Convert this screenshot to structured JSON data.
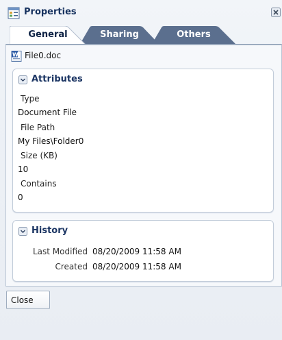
{
  "dialog": {
    "title": "Properties",
    "icon": "properties-icon",
    "close_icon": "close-icon"
  },
  "tabs": [
    {
      "label": "General",
      "selected": true
    },
    {
      "label": "Sharing",
      "selected": false
    },
    {
      "label": "Others",
      "selected": false
    }
  ],
  "file": {
    "name": "File0.doc",
    "icon": "word-document-icon"
  },
  "attributes": {
    "title": "Attributes",
    "items": [
      {
        "label": "Type",
        "value": "Document File"
      },
      {
        "label": "File Path",
        "value": "My Files\\Folder0"
      },
      {
        "label": "Size (KB)",
        "value": "10"
      },
      {
        "label": "Contains",
        "value": "0"
      }
    ]
  },
  "history": {
    "title": "History",
    "items": [
      {
        "label": "Last Modified",
        "value": "08/20/2009 11:58 AM"
      },
      {
        "label": "Created",
        "value": "08/20/2009 11:58 AM"
      }
    ]
  },
  "footer": {
    "close_label": "Close"
  },
  "colors": {
    "title_text": "#17325f",
    "tab_selected_bg": "#ffffff",
    "tab_unselected_bg": "#5a6f8f",
    "panel_border": "#c3cdda",
    "panel_title": "#1b3563"
  }
}
